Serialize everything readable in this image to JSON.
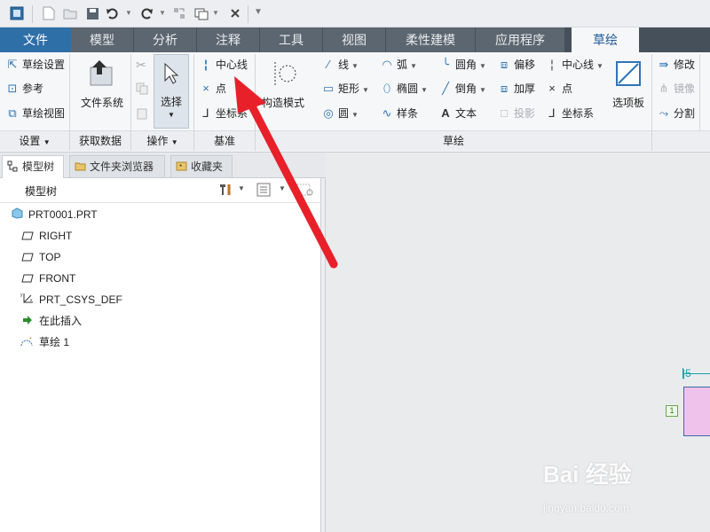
{
  "tabs": {
    "file": "文件",
    "model": "模型",
    "analysis": "分析",
    "annotate": "注释",
    "tools": "工具",
    "view": "视图",
    "flexible": "柔性建模",
    "apps": "应用程序",
    "sketch": "草绘"
  },
  "ribbon": {
    "setup": {
      "sketch_setup": "草绘设置",
      "reference": "参考",
      "sketch_view": "草绘视图",
      "footer": "设置"
    },
    "get_data": {
      "file_system": "文件系统",
      "footer": "获取数据"
    },
    "operations": {
      "select": "选择",
      "footer": "操作"
    },
    "datum": {
      "centerline": "中心线",
      "point": "点",
      "csys": "坐标系",
      "footer": "基准"
    },
    "construction_mode": "构造模式",
    "sketching": {
      "line": "线",
      "rectangle": "矩形",
      "circle": "圆",
      "arc": "弧",
      "ellipse": "椭圆",
      "spline": "样条",
      "fillet": "圆角",
      "chamfer": "倒角",
      "text": "文本",
      "offset": "偏移",
      "thicken": "加厚",
      "project": "投影",
      "centerline": "中心线",
      "point": "点",
      "csys": "坐标系",
      "footer": "草绘"
    },
    "palette": "选项板",
    "editing": {
      "modify": "修改",
      "mirror": "镜像",
      "divide": "分割"
    }
  },
  "panel": {
    "tabs": [
      "模型树",
      "文件夹浏览器",
      "收藏夹"
    ],
    "title": "模型树",
    "tree": [
      {
        "label": "PRT0001.PRT",
        "icon": "part-icon"
      },
      {
        "label": "RIGHT",
        "icon": "datum-plane-icon"
      },
      {
        "label": "TOP",
        "icon": "datum-plane-icon"
      },
      {
        "label": "FRONT",
        "icon": "datum-plane-icon"
      },
      {
        "label": "PRT_CSYS_DEF",
        "icon": "csys-icon"
      },
      {
        "label": "在此插入",
        "icon": "insert-here-arrow-icon"
      },
      {
        "label": "草绘 1",
        "icon": "sketch-icon"
      }
    ]
  },
  "canvas": {
    "dimension": "5",
    "constraint": "1"
  },
  "watermark": {
    "main": "Bai 经验",
    "sub": "jingyan.baidu.com"
  },
  "colors": {
    "tab_bar": "#46505a",
    "file_tab": "#2f6fa8",
    "annotation_arrow": "#e8202a",
    "sketch_fill": "#efc2ec"
  }
}
